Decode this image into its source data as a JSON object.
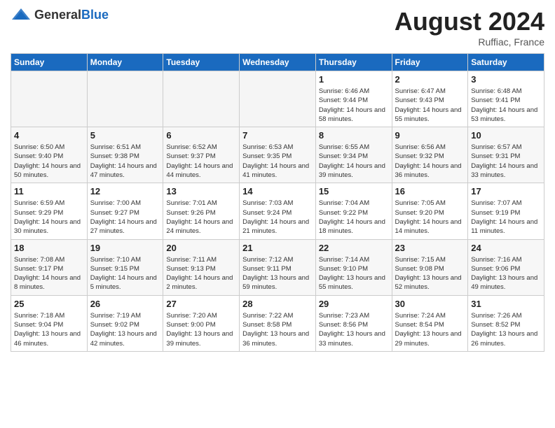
{
  "header": {
    "logo_general": "General",
    "logo_blue": "Blue",
    "month_year": "August 2024",
    "location": "Ruffiac, France"
  },
  "days_of_week": [
    "Sunday",
    "Monday",
    "Tuesday",
    "Wednesday",
    "Thursday",
    "Friday",
    "Saturday"
  ],
  "weeks": [
    {
      "days": [
        {
          "num": "",
          "empty": true
        },
        {
          "num": "",
          "empty": true
        },
        {
          "num": "",
          "empty": true
        },
        {
          "num": "",
          "empty": true
        },
        {
          "num": "1",
          "sunrise": "6:46 AM",
          "sunset": "9:44 PM",
          "daylight": "14 hours and 58 minutes."
        },
        {
          "num": "2",
          "sunrise": "6:47 AM",
          "sunset": "9:43 PM",
          "daylight": "14 hours and 55 minutes."
        },
        {
          "num": "3",
          "sunrise": "6:48 AM",
          "sunset": "9:41 PM",
          "daylight": "14 hours and 53 minutes."
        }
      ]
    },
    {
      "days": [
        {
          "num": "4",
          "sunrise": "6:50 AM",
          "sunset": "9:40 PM",
          "daylight": "14 hours and 50 minutes."
        },
        {
          "num": "5",
          "sunrise": "6:51 AM",
          "sunset": "9:38 PM",
          "daylight": "14 hours and 47 minutes."
        },
        {
          "num": "6",
          "sunrise": "6:52 AM",
          "sunset": "9:37 PM",
          "daylight": "14 hours and 44 minutes."
        },
        {
          "num": "7",
          "sunrise": "6:53 AM",
          "sunset": "9:35 PM",
          "daylight": "14 hours and 41 minutes."
        },
        {
          "num": "8",
          "sunrise": "6:55 AM",
          "sunset": "9:34 PM",
          "daylight": "14 hours and 39 minutes."
        },
        {
          "num": "9",
          "sunrise": "6:56 AM",
          "sunset": "9:32 PM",
          "daylight": "14 hours and 36 minutes."
        },
        {
          "num": "10",
          "sunrise": "6:57 AM",
          "sunset": "9:31 PM",
          "daylight": "14 hours and 33 minutes."
        }
      ]
    },
    {
      "days": [
        {
          "num": "11",
          "sunrise": "6:59 AM",
          "sunset": "9:29 PM",
          "daylight": "14 hours and 30 minutes."
        },
        {
          "num": "12",
          "sunrise": "7:00 AM",
          "sunset": "9:27 PM",
          "daylight": "14 hours and 27 minutes."
        },
        {
          "num": "13",
          "sunrise": "7:01 AM",
          "sunset": "9:26 PM",
          "daylight": "14 hours and 24 minutes."
        },
        {
          "num": "14",
          "sunrise": "7:03 AM",
          "sunset": "9:24 PM",
          "daylight": "14 hours and 21 minutes."
        },
        {
          "num": "15",
          "sunrise": "7:04 AM",
          "sunset": "9:22 PM",
          "daylight": "14 hours and 18 minutes."
        },
        {
          "num": "16",
          "sunrise": "7:05 AM",
          "sunset": "9:20 PM",
          "daylight": "14 hours and 14 minutes."
        },
        {
          "num": "17",
          "sunrise": "7:07 AM",
          "sunset": "9:19 PM",
          "daylight": "14 hours and 11 minutes."
        }
      ]
    },
    {
      "days": [
        {
          "num": "18",
          "sunrise": "7:08 AM",
          "sunset": "9:17 PM",
          "daylight": "14 hours and 8 minutes."
        },
        {
          "num": "19",
          "sunrise": "7:10 AM",
          "sunset": "9:15 PM",
          "daylight": "14 hours and 5 minutes."
        },
        {
          "num": "20",
          "sunrise": "7:11 AM",
          "sunset": "9:13 PM",
          "daylight": "14 hours and 2 minutes."
        },
        {
          "num": "21",
          "sunrise": "7:12 AM",
          "sunset": "9:11 PM",
          "daylight": "13 hours and 59 minutes."
        },
        {
          "num": "22",
          "sunrise": "7:14 AM",
          "sunset": "9:10 PM",
          "daylight": "13 hours and 55 minutes."
        },
        {
          "num": "23",
          "sunrise": "7:15 AM",
          "sunset": "9:08 PM",
          "daylight": "13 hours and 52 minutes."
        },
        {
          "num": "24",
          "sunrise": "7:16 AM",
          "sunset": "9:06 PM",
          "daylight": "13 hours and 49 minutes."
        }
      ]
    },
    {
      "days": [
        {
          "num": "25",
          "sunrise": "7:18 AM",
          "sunset": "9:04 PM",
          "daylight": "13 hours and 46 minutes."
        },
        {
          "num": "26",
          "sunrise": "7:19 AM",
          "sunset": "9:02 PM",
          "daylight": "13 hours and 42 minutes."
        },
        {
          "num": "27",
          "sunrise": "7:20 AM",
          "sunset": "9:00 PM",
          "daylight": "13 hours and 39 minutes."
        },
        {
          "num": "28",
          "sunrise": "7:22 AM",
          "sunset": "8:58 PM",
          "daylight": "13 hours and 36 minutes."
        },
        {
          "num": "29",
          "sunrise": "7:23 AM",
          "sunset": "8:56 PM",
          "daylight": "13 hours and 33 minutes."
        },
        {
          "num": "30",
          "sunrise": "7:24 AM",
          "sunset": "8:54 PM",
          "daylight": "13 hours and 29 minutes."
        },
        {
          "num": "31",
          "sunrise": "7:26 AM",
          "sunset": "8:52 PM",
          "daylight": "13 hours and 26 minutes."
        }
      ]
    }
  ]
}
